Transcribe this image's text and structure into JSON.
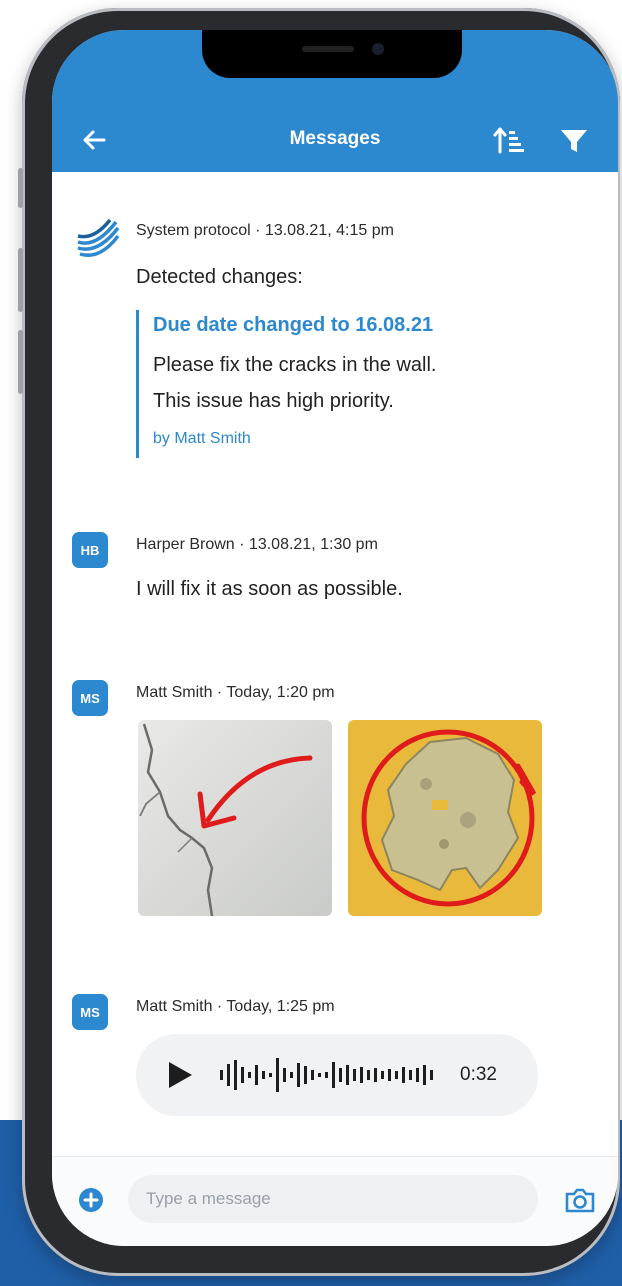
{
  "header": {
    "title": "Messages"
  },
  "messages": [
    {
      "sender": "System protocol",
      "meta": "System protocol · 13.08.21, 4:15 pm",
      "text": "Detected changes:",
      "quote": {
        "title": "Due date changed to 16.08.21",
        "lines": [
          "Please fix the cracks in the wall.",
          "This issue has high priority."
        ],
        "by": "by Matt Smith"
      }
    },
    {
      "avatar": "HB",
      "meta": "Harper Brown · 13.08.21, 1:30 pm",
      "text": "I will fix it as soon as possible."
    },
    {
      "avatar": "MS",
      "meta": "Matt Smith · Today, 1:20 pm"
    },
    {
      "avatar": "MS",
      "meta": "Matt Smith · Today, 1:25 pm",
      "voice": {
        "duration": "0:32"
      }
    }
  ],
  "composer": {
    "placeholder": "Type a message"
  },
  "colors": {
    "accent": "#2c88cf",
    "brand_band": "#1f5fa8",
    "annotation_red": "#e01b1b",
    "wall_yellow": "#e8b93a"
  },
  "icons": [
    "back-arrow-icon",
    "sort-icon",
    "filter-icon",
    "system-logo-icon",
    "play-icon",
    "waveform-icon",
    "plus-circle-icon",
    "camera-icon"
  ]
}
